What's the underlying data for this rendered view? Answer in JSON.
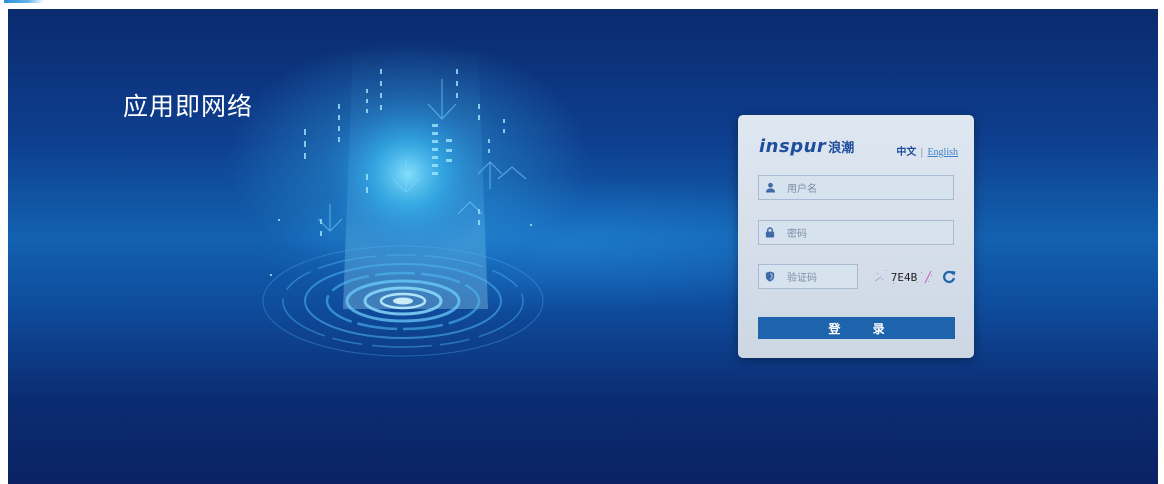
{
  "slogan": "应用即网络",
  "logo": {
    "text_en": "inspur",
    "text_cn": "浪潮"
  },
  "language": {
    "zh": "中文",
    "separator": "|",
    "en": "English"
  },
  "form": {
    "username_placeholder": "用户名",
    "password_placeholder": "密码",
    "captcha_placeholder": "验证码",
    "captcha_text": "7E4B",
    "login_label": "登 录"
  },
  "colors": {
    "brand": "#1e4f9d",
    "button": "#1d64ad",
    "background": "#0e3f8f"
  }
}
